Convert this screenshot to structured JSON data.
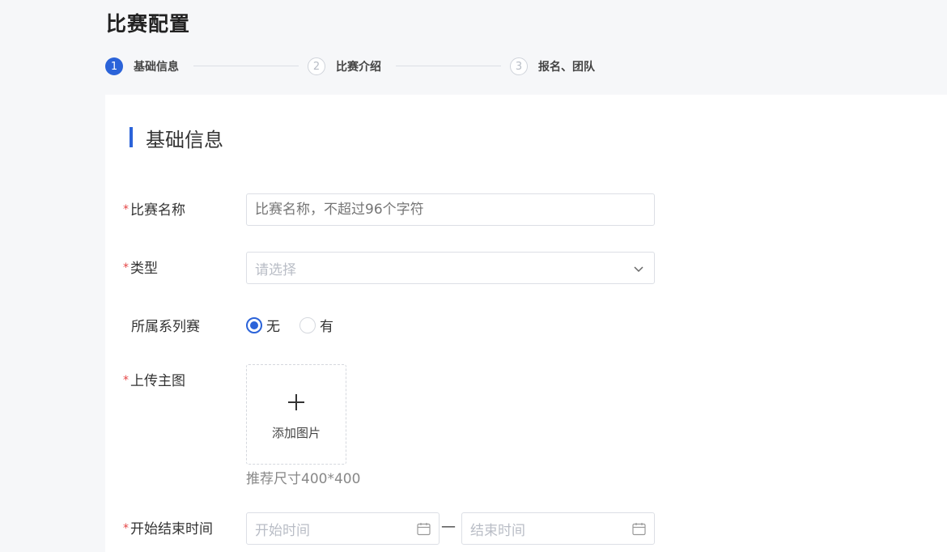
{
  "page": {
    "title": "比赛配置"
  },
  "steps": [
    {
      "number": "1",
      "label": "基础信息",
      "state": "active"
    },
    {
      "number": "2",
      "label": "比赛介绍",
      "state": "inactive"
    },
    {
      "number": "3",
      "label": "报名、团队",
      "state": "inactive"
    }
  ],
  "section": {
    "title": "基础信息"
  },
  "form": {
    "required_mark": "*",
    "name": {
      "label": "比赛名称",
      "placeholder": "比赛名称，不超过96个字符",
      "value": ""
    },
    "type": {
      "label": "类型",
      "placeholder": "请选择",
      "icon": "chevron-down-icon"
    },
    "series": {
      "label": "所属系列赛",
      "options": [
        {
          "label": "无",
          "checked": true
        },
        {
          "label": "有",
          "checked": false
        }
      ]
    },
    "image": {
      "label": "上传主图",
      "add_text": "添加图片",
      "hint": "推荐尺寸400*400",
      "icon": "plus-icon"
    },
    "time": {
      "label": "开始结束时间",
      "start_placeholder": "开始时间",
      "end_placeholder": "结束时间",
      "separator": "—",
      "icon": "calendar-icon"
    }
  },
  "colors": {
    "accent": "#2b63d9",
    "required": "#e54545",
    "background": "#f6f7f9"
  }
}
